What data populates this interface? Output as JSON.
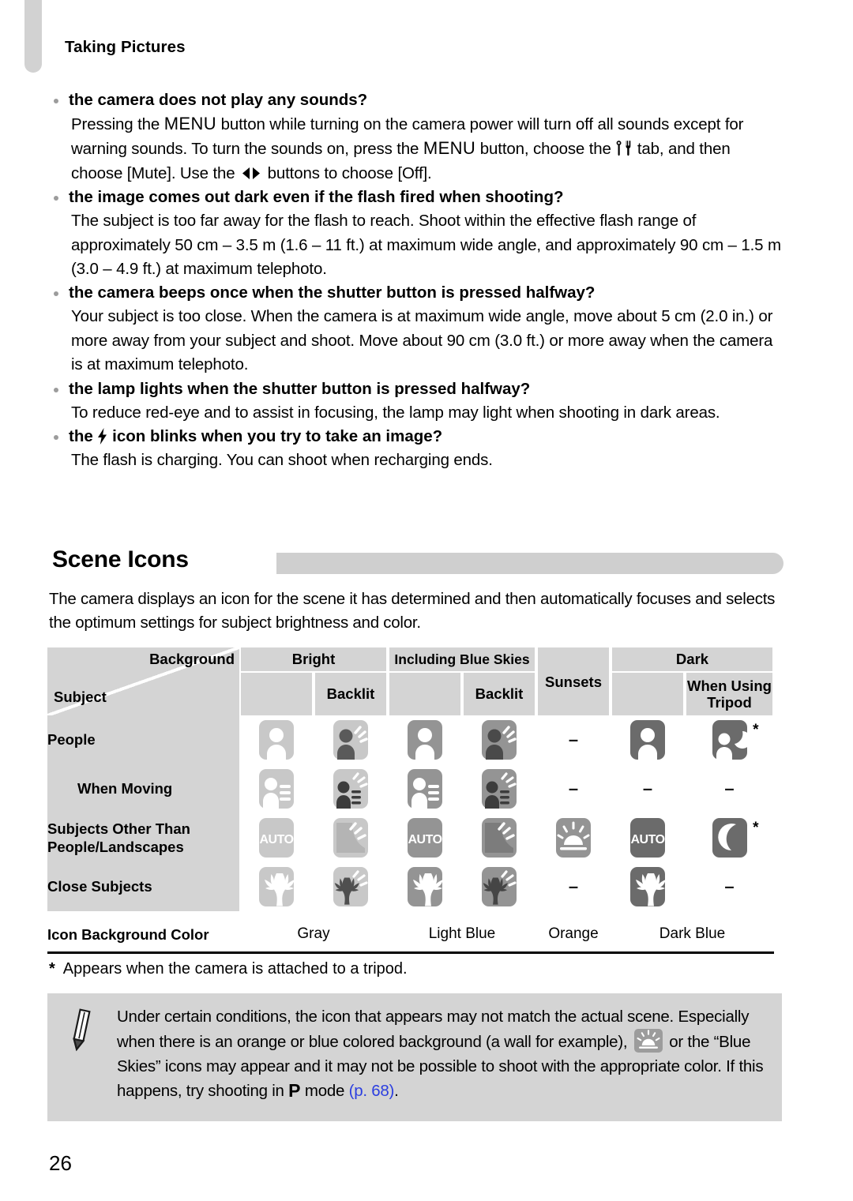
{
  "running_head": "Taking Pictures",
  "page_number": "26",
  "faq": [
    {
      "question": "the camera does not play any sounds?",
      "answer_parts": [
        "Pressing the ",
        "MENU",
        " button while turning on the camera power will turn off all sounds except for warning sounds. To turn the sounds on, press the ",
        "MENU",
        " button, choose the ",
        "[tools-icon]",
        " tab, and then choose [Mute]. Use the ",
        "[left-right-icon]",
        " buttons to choose [Off]."
      ],
      "answer_plain": "Pressing the MENU button while turning on the camera power will turn off all sounds except for warning sounds. To turn the sounds on, press the MENU button, choose the tab, and then choose [Mute]. Use the buttons to choose [Off]."
    },
    {
      "question": "the image comes out dark even if the flash fired when shooting?",
      "answer_plain": "The subject is too far away for the flash to reach. Shoot within the effective flash range of approximately 50 cm – 3.5 m (1.6 – 11 ft.) at maximum wide angle, and approximately 90 cm – 1.5 m (3.0 – 4.9 ft.) at maximum telephoto."
    },
    {
      "question": "the camera beeps once when the shutter button is pressed halfway?",
      "answer_plain": "Your subject is too close. When the camera is at maximum wide angle, move about 5 cm (2.0 in.) or more away from your subject and shoot. Move about 90 cm (3.0 ft.) or more away when the camera is at maximum telephoto."
    },
    {
      "question": "the lamp lights when the shutter button is pressed halfway?",
      "answer_plain": "To reduce red-eye and to assist in focusing, the lamp may light when shooting in dark areas."
    },
    {
      "question_prefix": "the ",
      "question_icon": "flash-icon",
      "question_suffix": " icon blinks when you try to take an image?",
      "answer_plain": "The flash is charging. You can shoot when recharging ends."
    }
  ],
  "section": {
    "title": "Scene Icons",
    "intro": "The camera displays an icon for the scene it has determined and then automatically focuses and selects the optimum settings for subject brightness and color."
  },
  "table": {
    "corner": {
      "background_label": "Background",
      "subject_label": "Subject"
    },
    "groups": [
      {
        "label": "Bright",
        "sub": [
          "",
          "Backlit"
        ]
      },
      {
        "label": "Including Blue Skies",
        "sub": [
          "",
          "Backlit"
        ]
      },
      {
        "label": "Sunsets",
        "sub": [
          ""
        ]
      },
      {
        "label": "Dark",
        "sub": [
          "",
          "When Using Tripod"
        ]
      }
    ],
    "column_headers_flat": [
      "Bright",
      "Backlit",
      "Including Blue Skies",
      "Backlit",
      "Sunsets",
      "Dark",
      "When Using Tripod"
    ],
    "rows": [
      {
        "label": "People",
        "indent": false,
        "cells": [
          {
            "icon": "person-icon",
            "shade": "light",
            "rays": false,
            "dash": false,
            "star": false
          },
          {
            "icon": "person-backlit-icon",
            "shade": "light",
            "rays": true,
            "dash": false,
            "star": false
          },
          {
            "icon": "person-icon",
            "shade": "medium",
            "rays": false,
            "dash": false,
            "star": false
          },
          {
            "icon": "person-backlit-icon",
            "shade": "medium",
            "rays": true,
            "dash": false,
            "star": false
          },
          {
            "icon": "",
            "shade": "",
            "rays": false,
            "dash": true,
            "star": false
          },
          {
            "icon": "person-icon",
            "shade": "dark",
            "rays": false,
            "dash": false,
            "star": false
          },
          {
            "icon": "person-night-icon",
            "shade": "dark",
            "rays": false,
            "dash": false,
            "star": true
          }
        ]
      },
      {
        "label": "When Moving",
        "indent": true,
        "cells": [
          {
            "icon": "person-moving-icon",
            "shade": "light",
            "rays": false,
            "dash": false,
            "star": false
          },
          {
            "icon": "person-moving-backlit-icon",
            "shade": "light",
            "rays": true,
            "dash": false,
            "star": false
          },
          {
            "icon": "person-moving-icon",
            "shade": "medium",
            "rays": false,
            "dash": false,
            "star": false
          },
          {
            "icon": "person-moving-backlit-icon",
            "shade": "medium",
            "rays": true,
            "dash": false,
            "star": false
          },
          {
            "icon": "",
            "shade": "",
            "rays": false,
            "dash": true,
            "star": false
          },
          {
            "icon": "",
            "shade": "",
            "rays": false,
            "dash": true,
            "star": false
          },
          {
            "icon": "",
            "shade": "",
            "rays": false,
            "dash": true,
            "star": false
          }
        ]
      },
      {
        "label": "Subjects Other Than People/Landscapes",
        "indent": false,
        "cells": [
          {
            "icon": "auto-icon",
            "shade": "light",
            "rays": false,
            "dash": false,
            "star": false
          },
          {
            "icon": "backlit-icon",
            "shade": "light",
            "rays": true,
            "dash": false,
            "star": false
          },
          {
            "icon": "auto-icon",
            "shade": "medium",
            "rays": false,
            "dash": false,
            "star": false
          },
          {
            "icon": "backlit-icon",
            "shade": "medium",
            "rays": true,
            "dash": false,
            "star": false
          },
          {
            "icon": "sunset-icon",
            "shade": "medium",
            "rays": false,
            "dash": false,
            "star": false
          },
          {
            "icon": "auto-icon",
            "shade": "dark",
            "rays": false,
            "dash": false,
            "star": false
          },
          {
            "icon": "night-icon",
            "shade": "dark",
            "rays": false,
            "dash": false,
            "star": true
          }
        ]
      },
      {
        "label": "Close Subjects",
        "indent": false,
        "cells": [
          {
            "icon": "macro-icon",
            "shade": "light",
            "rays": false,
            "dash": false,
            "star": false
          },
          {
            "icon": "macro-backlit-icon",
            "shade": "light",
            "rays": true,
            "dash": false,
            "star": false
          },
          {
            "icon": "macro-icon",
            "shade": "medium",
            "rays": false,
            "dash": false,
            "star": false
          },
          {
            "icon": "macro-backlit-icon",
            "shade": "medium",
            "rays": true,
            "dash": false,
            "star": false
          },
          {
            "icon": "",
            "shade": "",
            "rays": false,
            "dash": true,
            "star": false
          },
          {
            "icon": "macro-icon",
            "shade": "dark",
            "rays": false,
            "dash": false,
            "star": false
          },
          {
            "icon": "",
            "shade": "",
            "rays": false,
            "dash": true,
            "star": false
          }
        ]
      }
    ],
    "color_row": {
      "label": "Icon Background Color",
      "values": [
        "Gray",
        "Light Blue",
        "Orange",
        "Dark Blue"
      ]
    }
  },
  "footnote": {
    "marker": "*",
    "text": "Appears when the camera is attached to a tripod."
  },
  "note": {
    "text_before_icon": "Under certain conditions, the icon that appears may not match the actual scene. Especially when there is an orange or blue colored background (a wall for example), ",
    "icon": "sunset-icon",
    "text_after_icon": " or the “Blue Skies” icons may appear and it may not be possible to shoot with the appropriate color. If this happens, try shooting in ",
    "mode_letter": "P",
    "text_mode": " mode ",
    "page_ref": "(p. 68)",
    "text_end": "."
  },
  "colors": {
    "tab_gray": "#d2d2d2",
    "header_gray": "#d4d4d4",
    "bar_gray": "#cfcfcf",
    "icon_light": "#c8c8c8",
    "icon_medium": "#949494",
    "icon_dark": "#6b6b6b",
    "link_blue": "#2b3ee0"
  }
}
